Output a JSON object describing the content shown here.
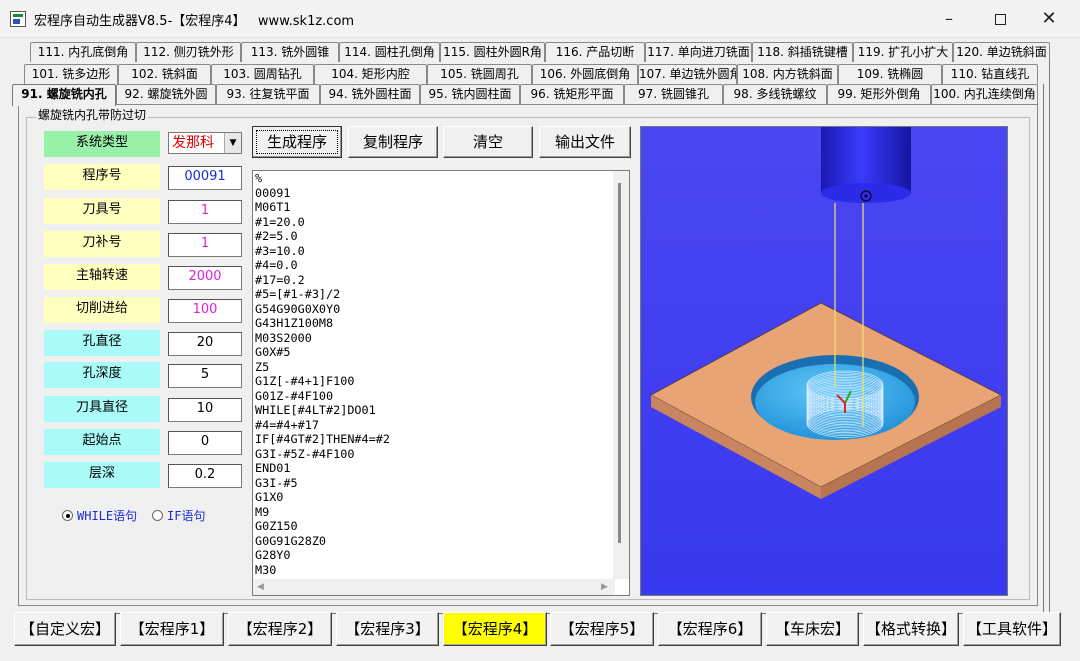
{
  "window": {
    "title": "宏程序自动生成器V8.5-【宏程序4】   www.sk1z.com"
  },
  "tabs": {
    "row1": [
      "111. 内孔底倒角",
      "112. 侧刃铣外形",
      "113. 铣外圆锥",
      "114. 圆柱孔倒角",
      "115. 圆柱外圆R角",
      "116. 产品切断",
      "117. 单向进刀铣面",
      "118. 斜插铣键槽",
      "119. 扩孔小扩大",
      "120. 单边铣斜面"
    ],
    "row2": [
      "101. 铣多边形",
      "102. 铣斜面",
      "103. 圆周钻孔",
      "104. 矩形内腔",
      "105. 铣圆周孔",
      "106. 外圆底倒角",
      "107. 单边铣外圆角",
      "108. 内方铣斜面",
      "109. 铣椭圆",
      "110. 钻直线孔"
    ],
    "row3": [
      "91. 螺旋铣内孔",
      "92. 螺旋铣外圆",
      "93. 往复铣平面",
      "94. 铣外圆柱面",
      "95. 铣内圆柱面",
      "96. 铣矩形平面",
      "97. 铣圆锥孔",
      "98. 多线铣螺纹",
      "99. 矩形外倒角",
      "100. 内孔连续倒角"
    ]
  },
  "group_title": "螺旋铣内孔带防过切",
  "system_type": {
    "label": "系统类型",
    "value": "发那科"
  },
  "params": [
    {
      "label": "程序号",
      "value": "00091",
      "color": "blue"
    },
    {
      "label": "刀具号",
      "value": "1",
      "color": "magenta"
    },
    {
      "label": "刀补号",
      "value": "1",
      "color": "magenta"
    },
    {
      "label": "主轴转速",
      "value": "2000",
      "color": "magenta"
    },
    {
      "label": "切削进给",
      "value": "100",
      "color": "magenta"
    },
    {
      "label": "孔直径",
      "value": "20",
      "color": "black"
    },
    {
      "label": "孔深度",
      "value": "5",
      "color": "black"
    },
    {
      "label": "刀具直径",
      "value": "10",
      "color": "black"
    },
    {
      "label": "起始点",
      "value": "0",
      "color": "black"
    },
    {
      "label": "层深",
      "value": "0.2",
      "color": "black"
    }
  ],
  "radio": {
    "while_label": "WHILE语句",
    "if_label": "IF语句",
    "selected": "while"
  },
  "buttons": {
    "generate": "生成程序",
    "copy": "复制程序",
    "clear": "清空",
    "export": "输出文件"
  },
  "code": "%\n00091\nM06T1\n#1=20.0\n#2=5.0\n#3=10.0\n#4=0.0\n#17=0.2\n#5=[#1-#3]/2\nG54G90G0X0Y0\nG43H1Z100M8\nM03S2000\nG0X#5\nZ5\nG1Z[-#4+1]F100\nG01Z-#4F100\nWHILE[#4LT#2]DO01\n#4=#4+#17\nIF[#4GT#2]THEN#4=#2\nG3I-#5Z-#4F100\nEND01\nG3I-#5\nG1X0\nM9\nG0Z150\nG0G91G28Z0\nG28Y0\nM30",
  "bottom_tabs": [
    "【自定义宏】",
    "【宏程序1】",
    "【宏程序2】",
    "【宏程序3】",
    "【宏程序4】",
    "【宏程序5】",
    "【宏程序6】",
    "【车床宏】",
    "【格式转换】",
    "【工具软件】"
  ],
  "bottom_active_index": 4,
  "colors": {
    "viewport_bg": "#3a3af0",
    "plate": "#e9a476",
    "hole": "#2a9ee0",
    "tool": "#2222dd",
    "active_bottom": "#ffff00"
  }
}
